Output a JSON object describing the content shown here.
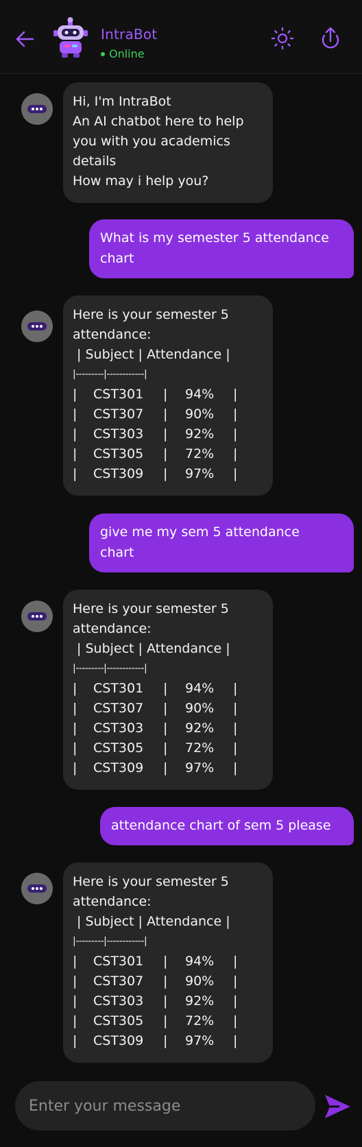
{
  "header": {
    "bot_name": "IntraBot",
    "status": "Online",
    "back_icon": "arrow-left-icon",
    "settings_icon": "brightness-icon",
    "share_icon": "upload-icon",
    "accent_color": "#a259ff",
    "status_color": "#3ecf5a"
  },
  "messages": {
    "welcome": {
      "lines": [
        "Hi, I'm IntraBot",
        "An AI chatbot here to help",
        "you with you academics",
        "details",
        "How may i help you?"
      ]
    },
    "user1": {
      "lines": [
        "What is my semester 5 attendance",
        "chart"
      ]
    },
    "bot1": {
      "lines": [
        "Here is your semester 5",
        "attendance:"
      ],
      "table_header": " | Subject | Attendance |",
      "table_sep": "|---------|------------|",
      "rows": [
        {
          "subject": "CST301",
          "attendance": "94%"
        },
        {
          "subject": "CST307",
          "attendance": "90%"
        },
        {
          "subject": "CST303",
          "attendance": "92%"
        },
        {
          "subject": "CST305",
          "attendance": "72%"
        },
        {
          "subject": "CST309",
          "attendance": "97%"
        }
      ]
    },
    "user2": {
      "lines": [
        "give me my sem 5 attendance",
        "chart"
      ]
    },
    "bot2": {
      "lines": [
        "Here is your semester 5",
        "attendance:"
      ],
      "table_header": " | Subject | Attendance |",
      "table_sep": "|---------|------------|",
      "rows": [
        {
          "subject": "CST301",
          "attendance": "94%"
        },
        {
          "subject": "CST307",
          "attendance": "90%"
        },
        {
          "subject": "CST303",
          "attendance": "92%"
        },
        {
          "subject": "CST305",
          "attendance": "72%"
        },
        {
          "subject": "CST309",
          "attendance": "97%"
        }
      ]
    },
    "user3": {
      "lines": [
        "attendance chart of sem 5 please"
      ]
    },
    "bot3": {
      "lines": [
        "Here is your semester 5",
        "attendance:"
      ],
      "table_header": " | Subject | Attendance |",
      "table_sep": "|---------|------------|",
      "rows": [
        {
          "subject": "CST301",
          "attendance": "94%"
        },
        {
          "subject": "CST307",
          "attendance": "90%"
        },
        {
          "subject": "CST303",
          "attendance": "92%"
        },
        {
          "subject": "CST305",
          "attendance": "72%"
        },
        {
          "subject": "CST309",
          "attendance": "97%"
        }
      ]
    }
  },
  "composer": {
    "placeholder": "Enter your message",
    "value": "",
    "send_icon": "send-icon",
    "send_color": "#8a30e0"
  },
  "colors": {
    "user_bubble": "#8a30e0",
    "bot_bubble": "#272727",
    "background": "#0e0e0e"
  }
}
